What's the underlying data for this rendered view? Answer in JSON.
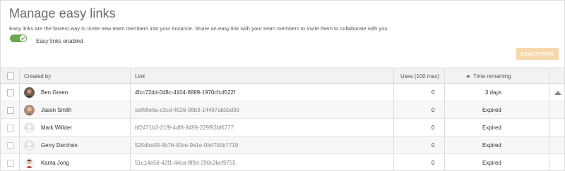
{
  "header": {
    "title": "Manage easy links",
    "description": "Easy links are the fastest way to invite new team members into your instance. Share an easy link with your team members to invite them to collaborate with you.",
    "toggle_label": "Easy links enabled",
    "toggle_on": true,
    "deactivate_label": "DEACTIVATE"
  },
  "colors": {
    "accent_green": "#6aa84f",
    "deactivate_bg": "#f7d8ac"
  },
  "table": {
    "columns": {
      "created_by": "Created by",
      "link": "Link",
      "uses": "Uses (100 max)",
      "time_remaining": "Time remaining"
    },
    "rows": [
      {
        "name": "Ben Green",
        "link": "4fcc72dd-048c-4104-8889-1970cfcd522f",
        "uses": "0",
        "time": "3 days",
        "avatar": "photo-avatar-icon"
      },
      {
        "name": "Jason Smith",
        "link": "eef68e6a-c3cd-4026-98b3-14497ab5bd99",
        "uses": "0",
        "time": "Expired",
        "avatar": "photo-avatar-icon"
      },
      {
        "name": "Mark Willder",
        "link": "bf2471b3-21f9-4df8-9499-229f93bf6777",
        "uses": "0",
        "time": "Expired",
        "avatar": "default-avatar-icon"
      },
      {
        "name": "Gerry Derchen",
        "link": "525dbe09-4b76-40ce-9e1e-0fef755b7719",
        "uses": "0",
        "time": "Expired",
        "avatar": "default-avatar-icon"
      },
      {
        "name": "Kanta Jong",
        "link": "51c14e56-42f1-44ca-8f9d-290c3bcf9755",
        "uses": "0",
        "time": "Expired",
        "avatar": "photo-avatar-icon"
      }
    ]
  }
}
